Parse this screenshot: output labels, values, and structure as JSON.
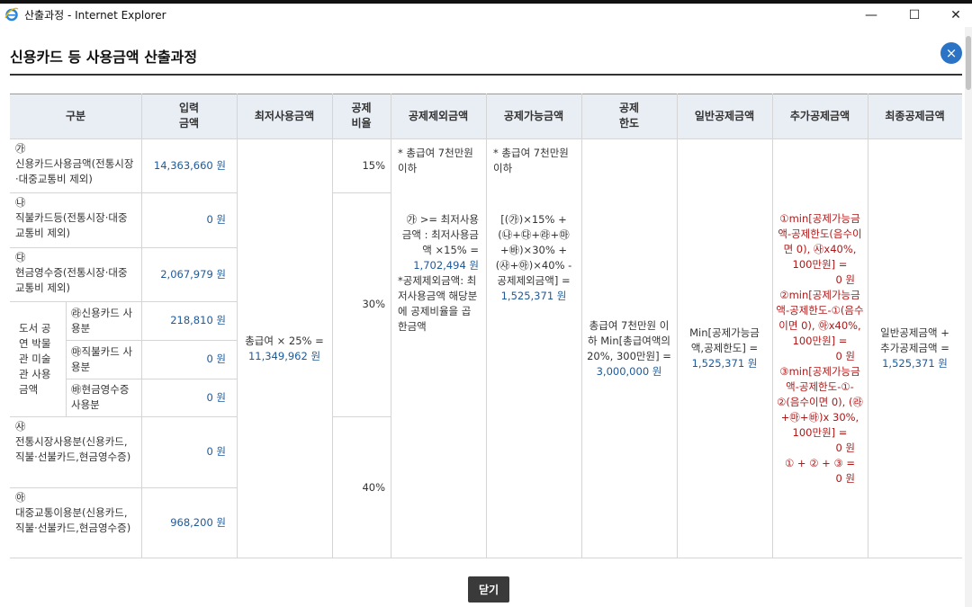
{
  "window": {
    "title": "산출과정 - Internet Explorer",
    "minimize": "—",
    "maximize": "☐",
    "close": "✕"
  },
  "page": {
    "title": "신용카드 등 사용금액 산출과정",
    "close_icon": "×",
    "close_button": "닫기"
  },
  "headers": {
    "gubun": "구분",
    "input1": "입력",
    "input2": "금액",
    "min_use": "최저사용금액",
    "rate1": "공제",
    "rate2": "비율",
    "excl": "공제제외금액",
    "avail": "공제가능금액",
    "limit1": "공제",
    "limit2": "한도",
    "general": "일반공제금액",
    "extra": "추가공제금액",
    "final": "최종공제금액"
  },
  "rows": {
    "ga": {
      "mark": "㉮",
      "label": "신용카드사용금액(전통시장·대중교통비 제외)",
      "amount": "14,363,660 원"
    },
    "na": {
      "mark": "㉯",
      "label": "직불카드등(전통시장·대중교통비 제외)",
      "amount": "0 원"
    },
    "da": {
      "mark": "㉰",
      "label": "현금영수증(전통시장·대중교통비 제외)",
      "amount": "2,067,979 원"
    },
    "culture": {
      "label": "도서 공연 박물관 미술관 사용 금액",
      "credit": {
        "label": "㉱신용카드 사용분",
        "amount": "218,810 원"
      },
      "debit": {
        "label": "㉲직불카드 사용분",
        "amount": "0 원"
      },
      "cash": {
        "label": "㉳현금영수증사용분",
        "amount": "0 원"
      }
    },
    "sa": {
      "mark": "㉴",
      "label": "전통시장사용분(신용카드,직불·선불카드,현금영수증)",
      "amount": "0 원"
    },
    "ah": {
      "mark": "㉵",
      "label": "대중교통이용분(신용카드,직불·선불카드,현금영수증)",
      "amount": "968,200 원"
    }
  },
  "rates": {
    "r15": "15%",
    "r30": "30%",
    "r40": "40%"
  },
  "min_use": {
    "text": "총급여 × 25% =",
    "amount": "11,349,962 원"
  },
  "excl": {
    "cond": "* 총급여 7천만원 이하",
    "formula": "㉮ >= 최저사용금액 : 최저사용금액 ×15% =",
    "amount": "1,702,494 원",
    "note": "*공제제외금액: 최저사용금액 해당분에 공제비율을 곱한금액"
  },
  "avail": {
    "cond": "* 총급여 7천만원 이하",
    "formula": "[(㉮)×15% + (㉯+㉰+㉱+㉲+㉳)×30% + (㉴+㉵)×40% - 공제제외금액] =",
    "amount": "1,525,371 원"
  },
  "limit": {
    "text": "총급여 7천만원 이하 Min[총급여액의 20%, 300만원] =",
    "amount": "3,000,000 원"
  },
  "general": {
    "text": "Min[공제가능금액,공제한도] =",
    "amount": "1,525,371 원"
  },
  "extra": {
    "f1": "①min[공제가능금액-공제한도(음수이면 0), ㉴x40%, 100만원] =",
    "v1": "0 원",
    "f2": "②min[공제가능금액-공제한도-①(음수이면 0), ㉵x40%, 100만원] =",
    "v2": "0 원",
    "f3": "③min[공제가능금액-공제한도-①-②(음수이면 0), (㉱+㉲+㉳)x 30%, 100만원] =",
    "v3": "0 원",
    "sum": "① + ② + ③ =",
    "vsum": "0 원"
  },
  "final": {
    "text": "일반공제금액 + 추가공제금액 =",
    "amount": "1,525,371 원"
  }
}
